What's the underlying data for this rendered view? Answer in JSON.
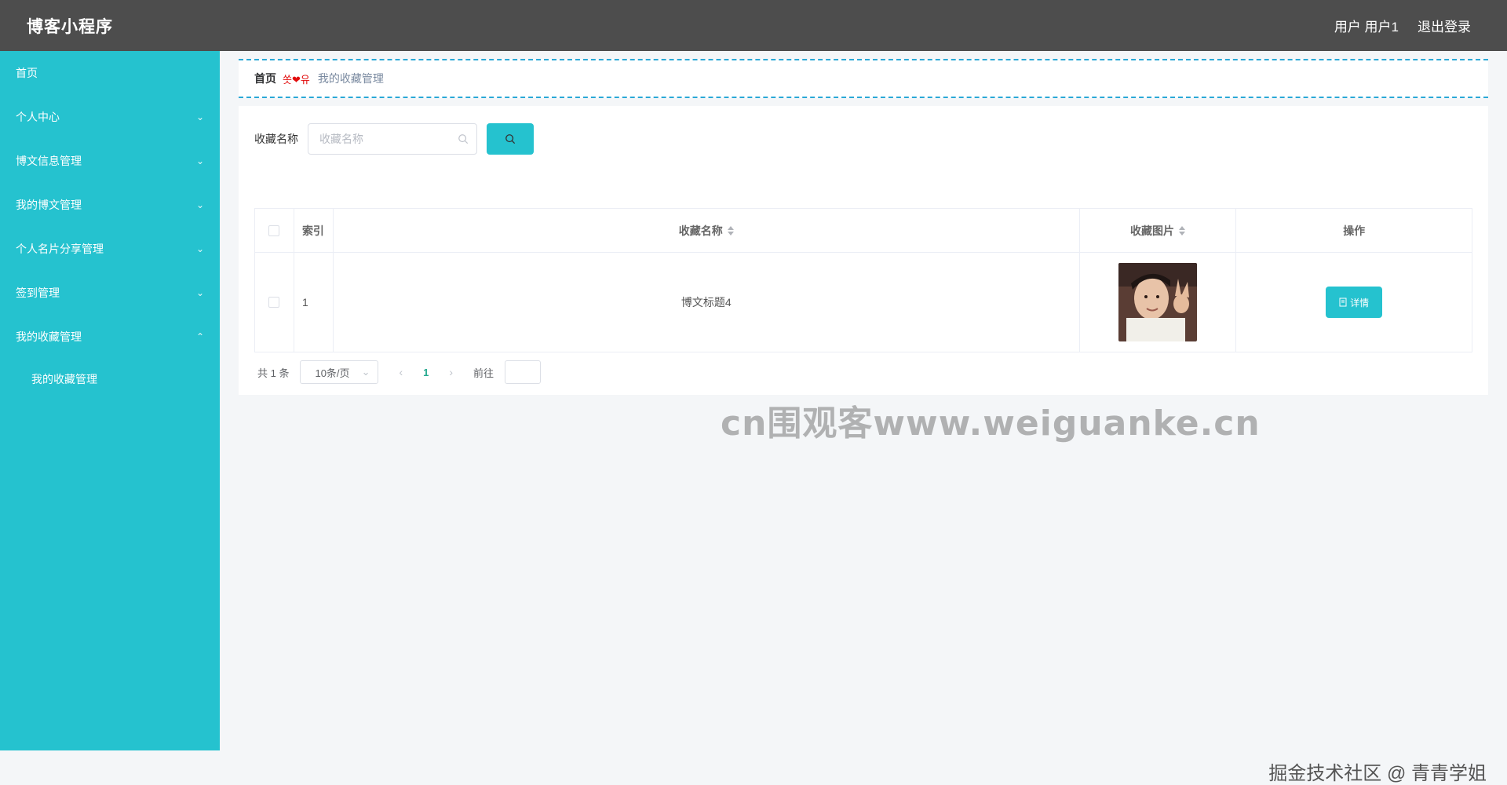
{
  "header": {
    "app_title": "博客小程序",
    "user_label": "用户 用户1",
    "logout_label": "退出登录"
  },
  "sidebar": {
    "items": [
      {
        "label": "首页",
        "has_children": false
      },
      {
        "label": "个人中心",
        "has_children": true
      },
      {
        "label": "博文信息管理",
        "has_children": true
      },
      {
        "label": "我的博文管理",
        "has_children": true
      },
      {
        "label": "个人名片分享管理",
        "has_children": true
      },
      {
        "label": "签到管理",
        "has_children": true
      },
      {
        "label": "我的收藏管理",
        "has_children": true,
        "expanded": true
      }
    ],
    "subitems": [
      {
        "label": "我的收藏管理"
      }
    ]
  },
  "breadcrumb": {
    "home": "首页",
    "separator": "쏫❤유",
    "current": "我的收藏管理"
  },
  "search": {
    "label": "收藏名称",
    "placeholder": "收藏名称"
  },
  "table": {
    "columns": [
      "索引",
      "收藏名称",
      "收藏图片",
      "操作"
    ],
    "rows": [
      {
        "index": "1",
        "name": "博文标题4",
        "image": "avatar-photo",
        "action": "详情"
      }
    ]
  },
  "pagination": {
    "total_text": "共 1 条",
    "page_size": "10条/页",
    "current_page": "1",
    "goto_label": "前往"
  },
  "watermark": "cn围观客www.weiguanke.cn",
  "footer_mark": "掘金技术社区 @ 青青学姐",
  "colors": {
    "header_bg": "#4d4d4d",
    "sidebar_bg": "#25c2cf",
    "accent": "#25c2cf",
    "breadcrumb_border": "#2aa8d7"
  }
}
